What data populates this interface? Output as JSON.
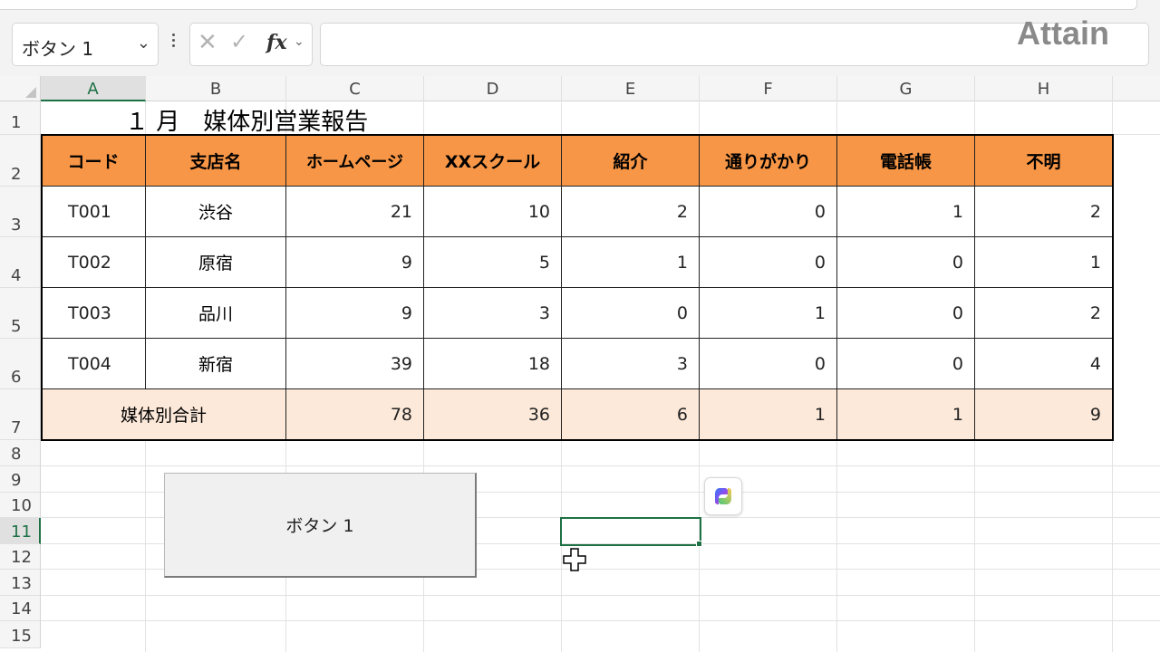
{
  "app": {
    "brand": "Attain"
  },
  "formula_bar": {
    "name_box_value": "ボタン 1",
    "fx_label": "fx",
    "formula_value": ""
  },
  "columns": [
    "A",
    "B",
    "C",
    "D",
    "E",
    "F",
    "G",
    "H"
  ],
  "rows": [
    "1",
    "2",
    "3",
    "4",
    "5",
    "6",
    "7",
    "8",
    "9",
    "10",
    "11",
    "12",
    "13",
    "14",
    "15"
  ],
  "selected": {
    "column": "E",
    "row": "11"
  },
  "sheet": {
    "title": "１ 月　媒体別営業報告",
    "headers": [
      "コード",
      "支店名",
      "ホームページ",
      "XXスクール",
      "紹介",
      "通りがかり",
      "電話帳",
      "不明"
    ],
    "data_rows": [
      {
        "code": "T001",
        "branch": "渋谷",
        "values": [
          "21",
          "10",
          "2",
          "0",
          "1",
          "2"
        ]
      },
      {
        "code": "T002",
        "branch": "原宿",
        "values": [
          "9",
          "5",
          "1",
          "0",
          "0",
          "1"
        ]
      },
      {
        "code": "T003",
        "branch": "品川",
        "values": [
          "9",
          "3",
          "0",
          "1",
          "0",
          "2"
        ]
      },
      {
        "code": "T004",
        "branch": "新宿",
        "values": [
          "39",
          "18",
          "3",
          "0",
          "0",
          "4"
        ]
      }
    ],
    "total_row": {
      "label": "媒体別合計",
      "values": [
        "78",
        "36",
        "6",
        "1",
        "1",
        "9"
      ]
    }
  },
  "form_button": {
    "label": "ボタン 1"
  },
  "colors": {
    "header_fill": "#f79646",
    "total_fill": "#fde9d9",
    "selection": "#1e7145"
  },
  "icons": [
    "chevron-down-icon",
    "more-options-icon",
    "cancel-icon",
    "enter-icon",
    "insert-function-icon",
    "copilot-icon",
    "cell-cursor-icon"
  ]
}
